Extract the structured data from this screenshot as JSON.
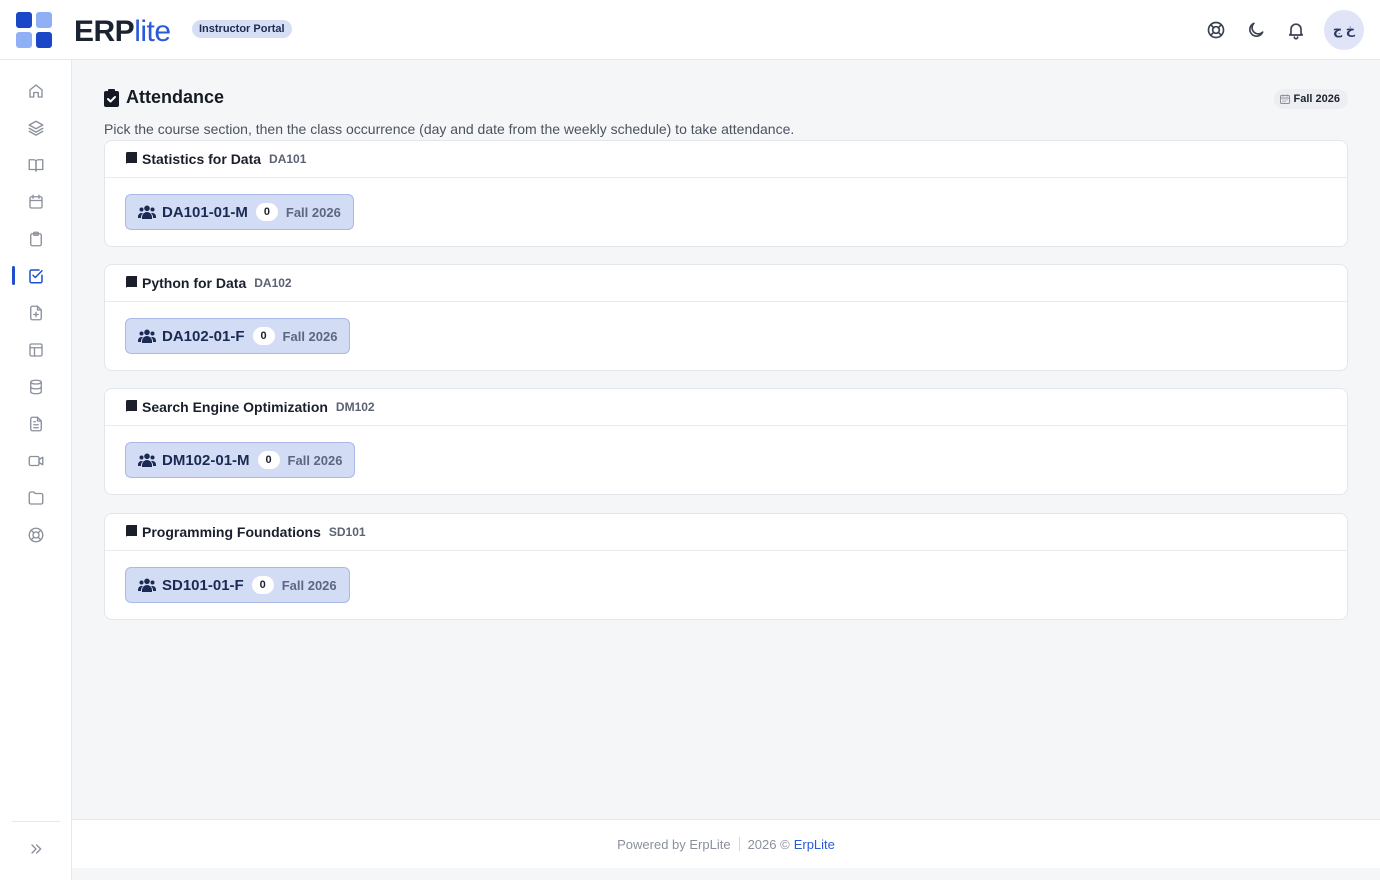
{
  "header": {
    "brand_primary": "ERP",
    "brand_secondary": "lite",
    "portal_badge": "Instructor Portal",
    "icons": [
      "lifebuoy-icon",
      "moon-icon",
      "bell-icon"
    ],
    "avatar_initials": "خ ج"
  },
  "sidebar": {
    "items": [
      {
        "icon": "home-icon",
        "active": false
      },
      {
        "icon": "layers-icon",
        "active": false
      },
      {
        "icon": "book-open-icon",
        "active": false
      },
      {
        "icon": "calendar-icon",
        "active": false
      },
      {
        "icon": "clipboard-icon",
        "active": false
      },
      {
        "icon": "checkbox-icon",
        "active": true
      },
      {
        "icon": "file-plus-icon",
        "active": false
      },
      {
        "icon": "layout-icon",
        "active": false
      },
      {
        "icon": "database-icon",
        "active": false
      },
      {
        "icon": "document-icon",
        "active": false
      },
      {
        "icon": "video-icon",
        "active": false
      },
      {
        "icon": "folder-icon",
        "active": false
      },
      {
        "icon": "lifebuoy-icon",
        "active": false
      }
    ],
    "expand_icon": "chevrons-right-icon"
  },
  "page": {
    "title": "Attendance",
    "term_chip": "Fall 2026",
    "subtitle": "Pick the course section, then the class occurrence (day and date from the weekly schedule) to take attendance."
  },
  "courses": [
    {
      "name": "Statistics for Data",
      "code": "DA101",
      "section": {
        "label": "DA101-01-M",
        "count": "0",
        "term": "Fall 2026"
      }
    },
    {
      "name": "Python for Data",
      "code": "DA102",
      "section": {
        "label": "DA102-01-F",
        "count": "0",
        "term": "Fall 2026"
      }
    },
    {
      "name": "Search Engine Optimization",
      "code": "DM102",
      "section": {
        "label": "DM102-01-M",
        "count": "0",
        "term": "Fall 2026"
      }
    },
    {
      "name": "Programming Foundations",
      "code": "SD101",
      "section": {
        "label": "SD101-01-F",
        "count": "0",
        "term": "Fall 2026"
      }
    }
  ],
  "footer": {
    "powered_by": "Powered by ErpLite",
    "copyright": "2026 ©",
    "link": "ErpLite"
  },
  "colors": {
    "accent": "#1f4fd1",
    "chip_bg": "#d3dcf5",
    "chip_border": "#a9b9e8"
  }
}
